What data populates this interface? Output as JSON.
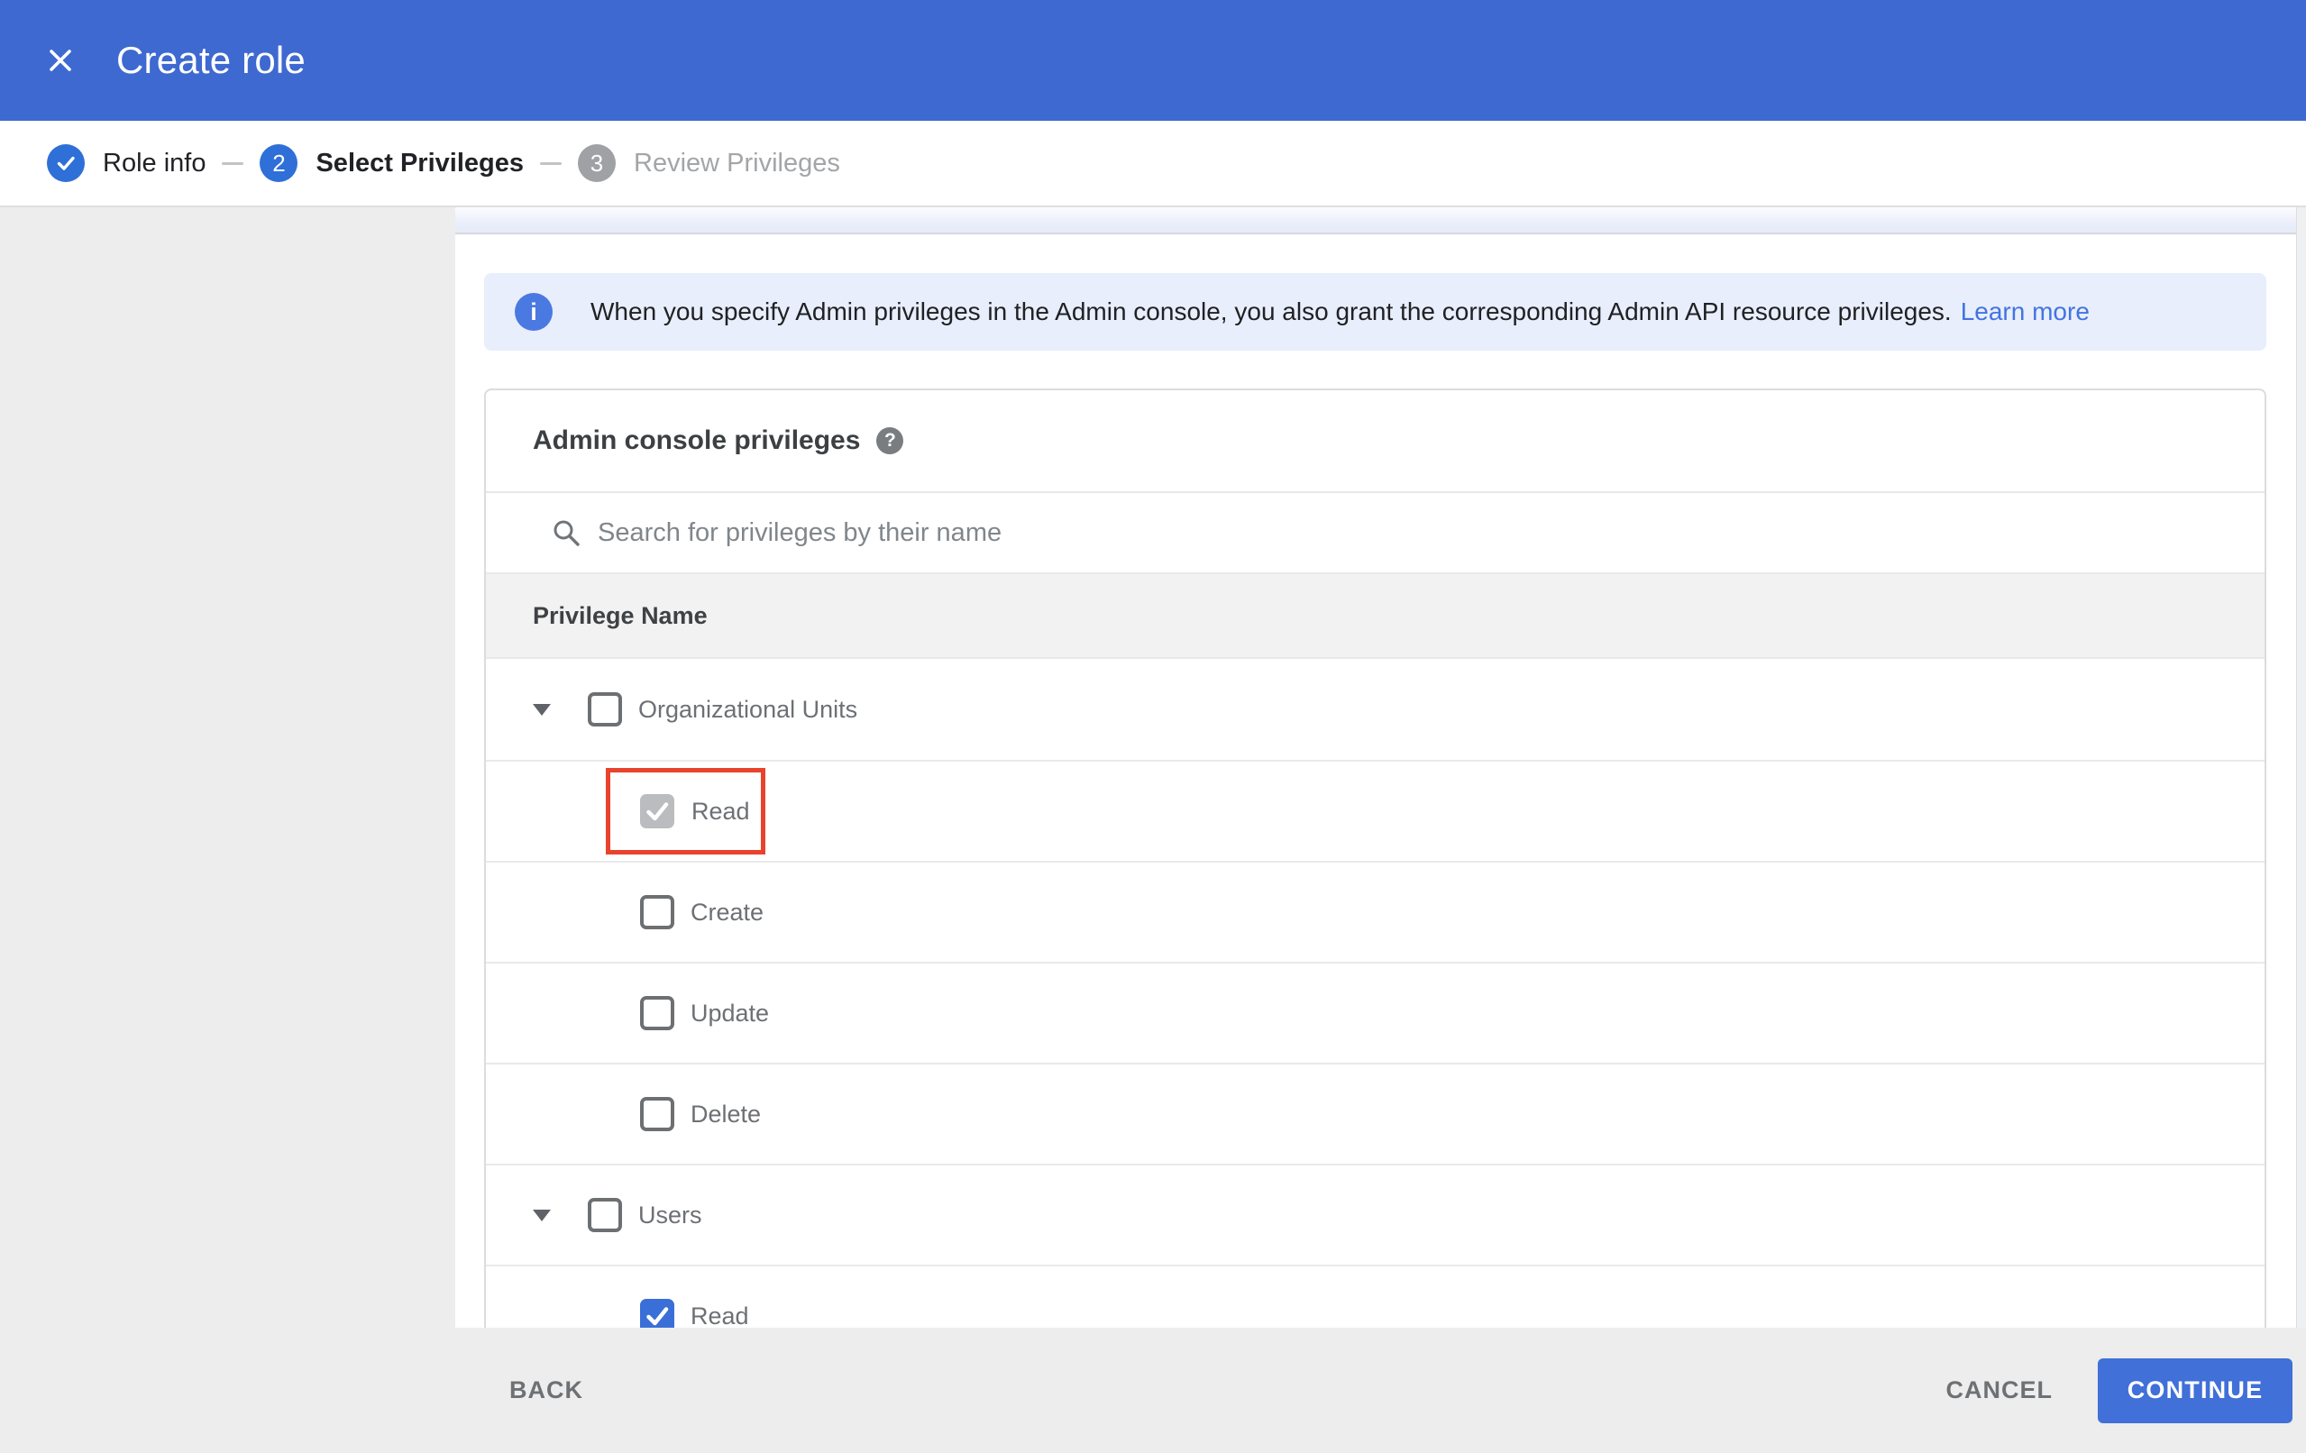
{
  "header": {
    "title": "Create role"
  },
  "stepper": {
    "steps": [
      {
        "number": "1",
        "label": "Role info",
        "state": "complete"
      },
      {
        "number": "2",
        "label": "Select Privileges",
        "state": "active"
      },
      {
        "number": "3",
        "label": "Review Privileges",
        "state": "upcoming"
      }
    ]
  },
  "info_banner": {
    "text": "When you specify Admin privileges in the Admin console, you also grant the corresponding Admin API resource privileges.",
    "link_label": "Learn more"
  },
  "privileges": {
    "section_title": "Admin console privileges",
    "search_placeholder": "Search for privileges by their name",
    "column_header": "Privilege Name",
    "rows": [
      {
        "label": "Organizational Units",
        "level": "group",
        "expanded": true,
        "checked": false
      },
      {
        "label": "Read",
        "level": "child",
        "checked": true,
        "disabled": true,
        "highlighted": true
      },
      {
        "label": "Create",
        "level": "child",
        "checked": false
      },
      {
        "label": "Update",
        "level": "child",
        "checked": false
      },
      {
        "label": "Delete",
        "level": "child",
        "checked": false
      },
      {
        "label": "Users",
        "level": "group",
        "expanded": true,
        "checked": false
      },
      {
        "label": "Read",
        "level": "child",
        "checked": true,
        "partially_visible": true
      }
    ]
  },
  "footer": {
    "back_label": "BACK",
    "cancel_label": "CANCEL",
    "continue_label": "CONTINUE"
  },
  "colors": {
    "appbar_blue": "#3e69d1",
    "step_blue": "#2f6fd8",
    "checked_blue": "#3a6fd8",
    "continue_blue": "#4070d8",
    "link_blue": "#4274e1",
    "banner_bg": "#e8eefb",
    "highlight_red": "#e8432d",
    "disabled_check_gray": "#babcbf"
  }
}
